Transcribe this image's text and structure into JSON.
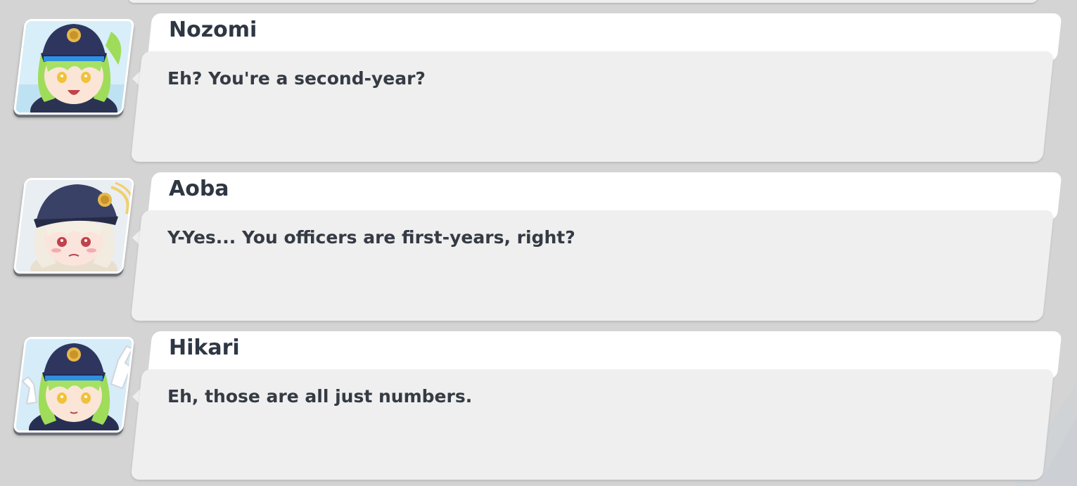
{
  "dialogue": [
    {
      "speaker": "Nozomi",
      "text": "Eh? You're a second-year?",
      "portrait_icon": "nozomi-portrait-icon"
    },
    {
      "speaker": "Aoba",
      "text": "Y-Yes... You officers are first-years, right?",
      "portrait_icon": "aoba-portrait-icon"
    },
    {
      "speaker": "Hikari",
      "text": "Eh, those are all just numbers.",
      "portrait_icon": "hikari-portrait-icon"
    }
  ],
  "colors": {
    "background": "#d4d4d4",
    "name_card": "#ffffff",
    "message_card": "#efefef",
    "text": "#353b44"
  }
}
